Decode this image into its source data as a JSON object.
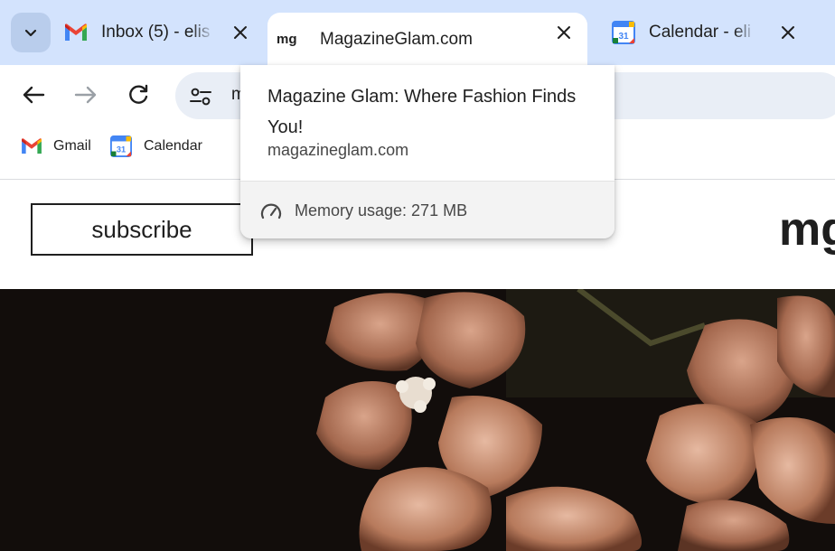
{
  "tabs": [
    {
      "title": "Inbox (5) - elis",
      "favicon": "gmail-icon",
      "active": false
    },
    {
      "title": "MagazineGlam.com",
      "favicon": "magazineglam-icon",
      "active": true
    },
    {
      "title": "Calendar - eli",
      "favicon": "calendar-icon",
      "active": false
    }
  ],
  "toolbar": {
    "address_text": "m"
  },
  "bookmarks": [
    {
      "label": "Gmail",
      "icon": "gmail-icon"
    },
    {
      "label": "Calendar",
      "icon": "calendar-icon"
    }
  ],
  "calendar_icon_day": "31",
  "hovercard": {
    "title": "Magazine Glam: Where Fashion Finds You!",
    "domain": "magazineglam.com",
    "memory": "Memory usage: 271 MB"
  },
  "page": {
    "subscribe_label": "subscribe",
    "logo_text": "mg"
  },
  "favicon_text": "mg",
  "colors": {
    "tabstrip": "#d3e3fd",
    "omnibox": "#e9eef6",
    "hero_bg": "#140f0c",
    "gmail_red": "#ea4335",
    "gmail_blue": "#4285f4",
    "gmail_green": "#34a853",
    "gmail_yellow": "#fbbc04"
  }
}
